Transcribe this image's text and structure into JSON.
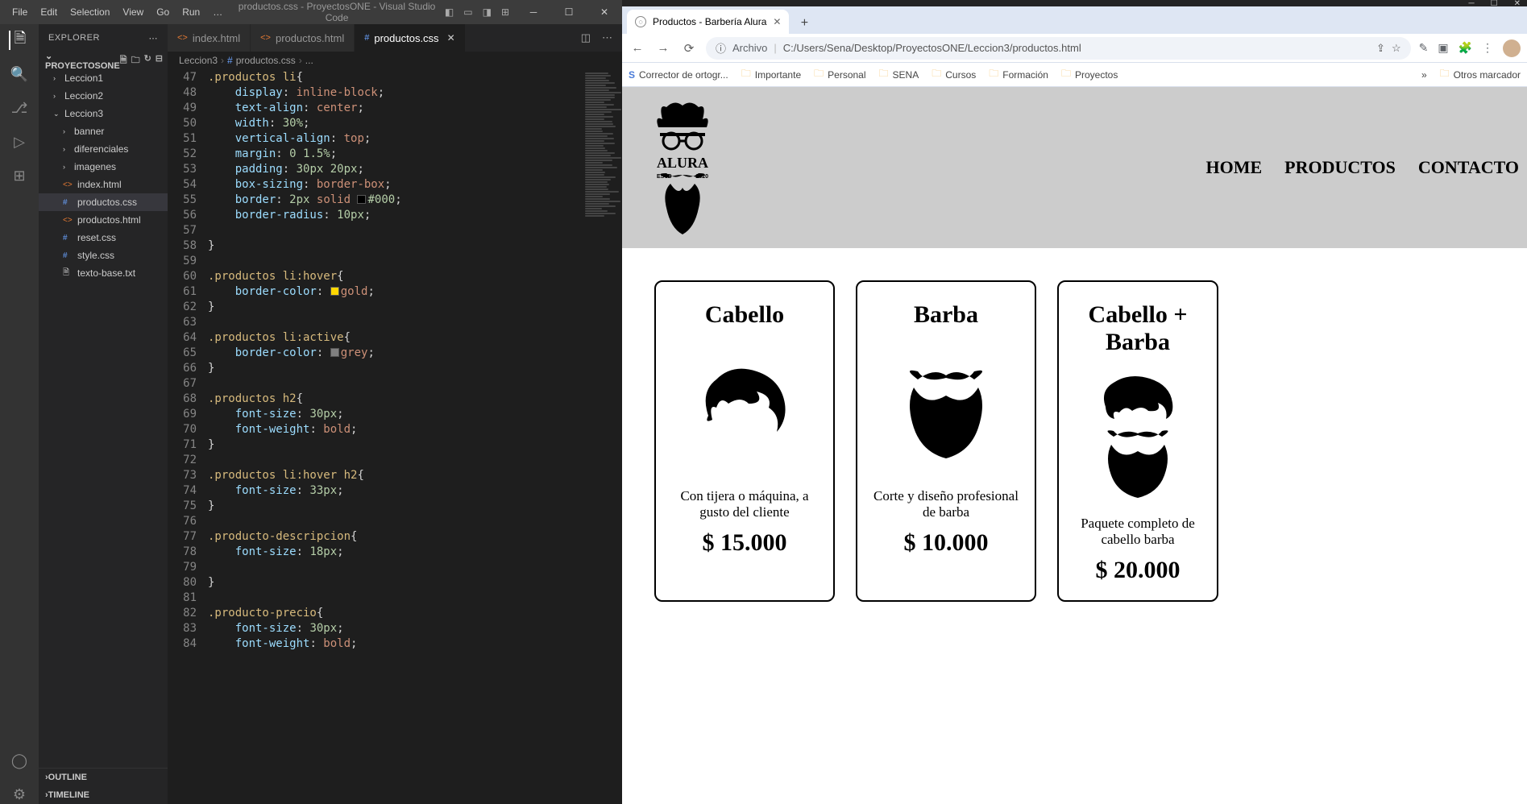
{
  "vscode": {
    "menus": [
      "File",
      "Edit",
      "Selection",
      "View",
      "Go",
      "Run"
    ],
    "title": "productos.css - ProyectosONE - Visual Studio Code",
    "explorer_label": "EXPLORER",
    "project_name": "PROYECTOSONE",
    "tree": {
      "leccion1": "Leccion1",
      "leccion2": "Leccion2",
      "leccion3": "Leccion3",
      "banner": "banner",
      "diferenciales": "diferenciales",
      "imagenes": "imagenes",
      "index": "index.html",
      "productoscss": "productos.css",
      "productoshtml": "productos.html",
      "reset": "reset.css",
      "style": "style.css",
      "texto": "texto-base.txt"
    },
    "outline": "OUTLINE",
    "timeline": "TIMELINE",
    "tabs": [
      {
        "name": "index.html",
        "icon": "html"
      },
      {
        "name": "productos.html",
        "icon": "html"
      },
      {
        "name": "productos.css",
        "icon": "css",
        "active": true
      }
    ],
    "breadcrumb": [
      "Leccion3",
      "productos.css",
      "..."
    ],
    "lines": [
      {
        "n": 47,
        "html": "<span class='sel'>.productos li</span><span class='pun'>{</span>"
      },
      {
        "n": 48,
        "html": "    <span class='prop'>display</span><span class='pun'>: </span><span class='val'>inline-block</span><span class='pun'>;</span>"
      },
      {
        "n": 49,
        "html": "    <span class='prop'>text-align</span><span class='pun'>: </span><span class='val'>center</span><span class='pun'>;</span>"
      },
      {
        "n": 50,
        "html": "    <span class='prop'>width</span><span class='pun'>: </span><span class='num'>30%</span><span class='pun'>;</span>"
      },
      {
        "n": 51,
        "html": "    <span class='prop'>vertical-align</span><span class='pun'>: </span><span class='val'>top</span><span class='pun'>;</span>"
      },
      {
        "n": 52,
        "html": "    <span class='prop'>margin</span><span class='pun'>: </span><span class='num'>0 1.5%</span><span class='pun'>;</span>"
      },
      {
        "n": 53,
        "html": "    <span class='prop'>padding</span><span class='pun'>: </span><span class='num'>30px 20px</span><span class='pun'>;</span>"
      },
      {
        "n": 54,
        "html": "    <span class='prop'>box-sizing</span><span class='pun'>: </span><span class='val'>border-box</span><span class='pun'>;</span>"
      },
      {
        "n": 55,
        "html": "    <span class='prop'>border</span><span class='pun'>: </span><span class='num'>2px</span> <span class='val'>solid</span> <span class='colorbox' style='background:#000'></span><span class='num'>#000</span><span class='pun'>;</span>"
      },
      {
        "n": 56,
        "html": "    <span class='prop'>border-radius</span><span class='pun'>: </span><span class='num'>10px</span><span class='pun'>;</span>"
      },
      {
        "n": 57,
        "html": ""
      },
      {
        "n": 58,
        "html": "<span class='pun'>}</span>"
      },
      {
        "n": 59,
        "html": ""
      },
      {
        "n": 60,
        "html": "<span class='sel'>.productos li:hover</span><span class='pun'>{</span>"
      },
      {
        "n": 61,
        "html": "    <span class='prop'>border-color</span><span class='pun'>: </span><span class='colorbox' style='background:gold'></span><span class='val'>gold</span><span class='pun'>;</span>"
      },
      {
        "n": 62,
        "html": "<span class='pun'>}</span>"
      },
      {
        "n": 63,
        "html": ""
      },
      {
        "n": 64,
        "html": "<span class='sel'>.productos li:active</span><span class='pun'>{</span>"
      },
      {
        "n": 65,
        "html": "    <span class='prop'>border-color</span><span class='pun'>: </span><span class='colorbox' style='background:grey'></span><span class='val'>grey</span><span class='pun'>;</span>"
      },
      {
        "n": 66,
        "html": "<span class='pun'>}</span>"
      },
      {
        "n": 67,
        "html": ""
      },
      {
        "n": 68,
        "html": "<span class='sel'>.productos h2</span><span class='pun'>{</span>"
      },
      {
        "n": 69,
        "html": "    <span class='prop'>font-size</span><span class='pun'>: </span><span class='num'>30px</span><span class='pun'>;</span>"
      },
      {
        "n": 70,
        "html": "    <span class='prop'>font-weight</span><span class='pun'>: </span><span class='val'>bold</span><span class='pun'>;</span>"
      },
      {
        "n": 71,
        "html": "<span class='pun'>}</span>"
      },
      {
        "n": 72,
        "html": ""
      },
      {
        "n": 73,
        "html": "<span class='sel'>.productos li:hover h2</span><span class='pun'>{</span>"
      },
      {
        "n": 74,
        "html": "    <span class='prop'>font-size</span><span class='pun'>: </span><span class='num'>33px</span><span class='pun'>;</span>"
      },
      {
        "n": 75,
        "html": "<span class='pun'>}</span>"
      },
      {
        "n": 76,
        "html": ""
      },
      {
        "n": 77,
        "html": "<span class='sel'>.producto-descripcion</span><span class='pun'>{</span>"
      },
      {
        "n": 78,
        "html": "    <span class='prop'>font-size</span><span class='pun'>: </span><span class='num'>18px</span><span class='pun'>;</span>"
      },
      {
        "n": 79,
        "html": ""
      },
      {
        "n": 80,
        "html": "<span class='pun'>}</span>"
      },
      {
        "n": 81,
        "html": ""
      },
      {
        "n": 82,
        "html": "<span class='sel'>.producto-precio</span><span class='pun'>{</span>"
      },
      {
        "n": 83,
        "html": "    <span class='prop'>font-size</span><span class='pun'>: </span><span class='num'>30px</span><span class='pun'>;</span>"
      },
      {
        "n": 84,
        "html": "    <span class='prop'>font-weight</span><span class='pun'>: </span><span class='val'>bold</span><span class='pun'>;</span>"
      }
    ]
  },
  "browser": {
    "tab_title": "Productos - Barbería Alura",
    "address_proto": "Archivo",
    "address_path": "C:/Users/Sena/Desktop/ProyectosONE/Leccion3/productos.html",
    "bookmarks": [
      {
        "label": "Corrector de ortogr...",
        "icon": "S"
      },
      {
        "label": "Importante",
        "icon": "folder"
      },
      {
        "label": "Personal",
        "icon": "folder"
      },
      {
        "label": "SENA",
        "icon": "folder"
      },
      {
        "label": "Cursos",
        "icon": "folder"
      },
      {
        "label": "Formación",
        "icon": "folder"
      },
      {
        "label": "Proyectos",
        "icon": "folder"
      }
    ],
    "other_bookmarks": "Otros marcador",
    "page": {
      "logo_name": "ALURA",
      "logo_est": "ESTD",
      "logo_year": "2020",
      "nav": [
        "HOME",
        "PRODUCTOS",
        "CONTACTO"
      ],
      "products": [
        {
          "title": "Cabello",
          "desc": "Con tijera o máquina, a gusto del cliente",
          "price": "$ 15.000",
          "svg": "hair"
        },
        {
          "title": "Barba",
          "desc": "Corte y diseño profesional de barba",
          "price": "$ 10.000",
          "svg": "beard"
        },
        {
          "title": "Cabello + Barba",
          "desc": "Paquete completo de cabello barba",
          "price": "$ 20.000",
          "svg": "both"
        }
      ]
    }
  }
}
